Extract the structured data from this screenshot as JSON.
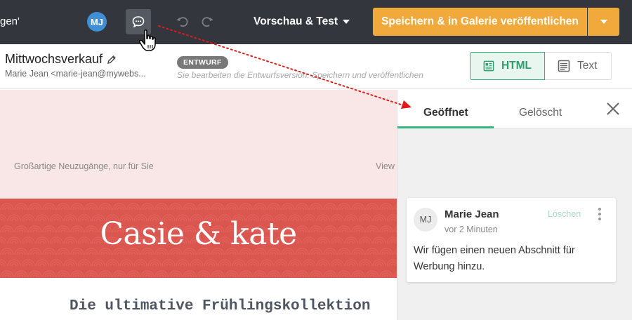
{
  "topbar": {
    "left_text": "gen'",
    "avatar_initials": "MJ",
    "comment_icon": "comment-bubble-icon",
    "undo_icon": "undo-icon",
    "redo_icon": "redo-icon",
    "preview_label": "Vorschau & Test",
    "save_label": "Speichern & in Galerie veröffentlichen",
    "background": "#33363d",
    "accent": "#f1a93b"
  },
  "subheader": {
    "title": "Mittwochsverkauf",
    "from": "Marie Jean <marie-jean@mywebs...",
    "draft_badge": "ENTWURF",
    "draft_hint": "Sie bearbeiten die Entwurfsversion. Speichern und veröffentlichen",
    "view_html": "HTML",
    "view_text": "Text",
    "active_view": "HTML"
  },
  "email": {
    "preheader": "Großartige Neuzugänge, nur für Sie",
    "view_link": "View",
    "brand": "Casie & kate",
    "headline": "Die ultimative Frühlingskollektion",
    "hero_color": "#dc5650",
    "preheader_color": "#f9e6e6"
  },
  "comments_panel": {
    "tab_open": "Geöffnet",
    "tab_deleted": "Gelöscht",
    "active_tab": "Geöffnet",
    "comment": {
      "avatar": "MJ",
      "author": "Marie Jean",
      "time": "vor 2 Minuten",
      "delete_label": "Löschen",
      "text": "Wir fügen einen neuen Abschnitt für Werbung hinzu."
    },
    "accent": "#36b37e"
  }
}
